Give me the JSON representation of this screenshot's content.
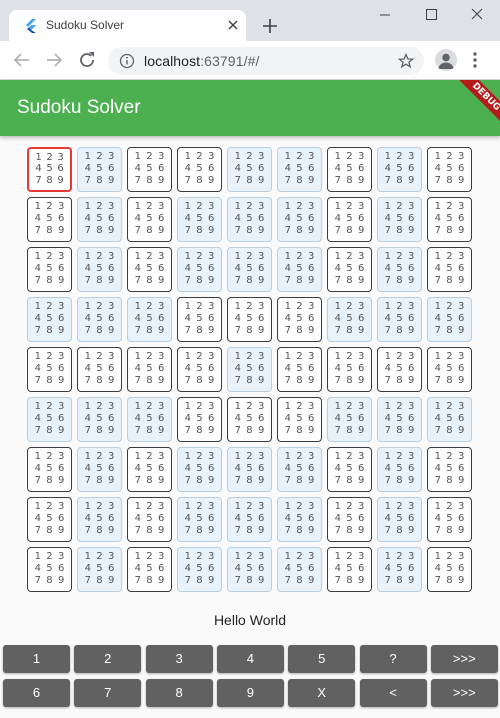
{
  "browser": {
    "tab_title": "Sudoku Solver",
    "url_host": "localhost",
    "url_rest": ":63791/#/",
    "favicon": "flutter-icon"
  },
  "app": {
    "title": "Sudoku Solver",
    "debug_label": "DEBUG",
    "status_text": "Hello World",
    "colors": {
      "appbar": "#4caf50",
      "selected_border": "#e53935",
      "light_cell_bg": "#e8f2fb",
      "key_bg": "#616161"
    }
  },
  "board": {
    "rows": 9,
    "cols": 9,
    "selected_cell": [
      0,
      0
    ],
    "candidates": [
      "1",
      "2",
      "3",
      "4",
      "5",
      "6",
      "7",
      "8",
      "9"
    ],
    "light_cells": [
      [
        0,
        1,
        0,
        0,
        1,
        1,
        0,
        1,
        0
      ],
      [
        0,
        1,
        0,
        1,
        1,
        1,
        0,
        1,
        0
      ],
      [
        0,
        1,
        0,
        1,
        1,
        1,
        0,
        1,
        0
      ],
      [
        1,
        1,
        1,
        0,
        0,
        0,
        1,
        1,
        1
      ],
      [
        0,
        0,
        0,
        0,
        1,
        0,
        0,
        0,
        0
      ],
      [
        1,
        1,
        1,
        0,
        0,
        0,
        1,
        1,
        1
      ],
      [
        0,
        1,
        0,
        1,
        1,
        1,
        0,
        1,
        0
      ],
      [
        0,
        1,
        0,
        1,
        1,
        1,
        0,
        1,
        0
      ],
      [
        0,
        1,
        0,
        1,
        1,
        1,
        0,
        1,
        0
      ]
    ]
  },
  "keypad": {
    "row1": [
      "1",
      "2",
      "3",
      "4",
      "5",
      "?",
      ">>>"
    ],
    "row2": [
      "6",
      "7",
      "8",
      "9",
      "X",
      "<",
      ">>>"
    ]
  }
}
